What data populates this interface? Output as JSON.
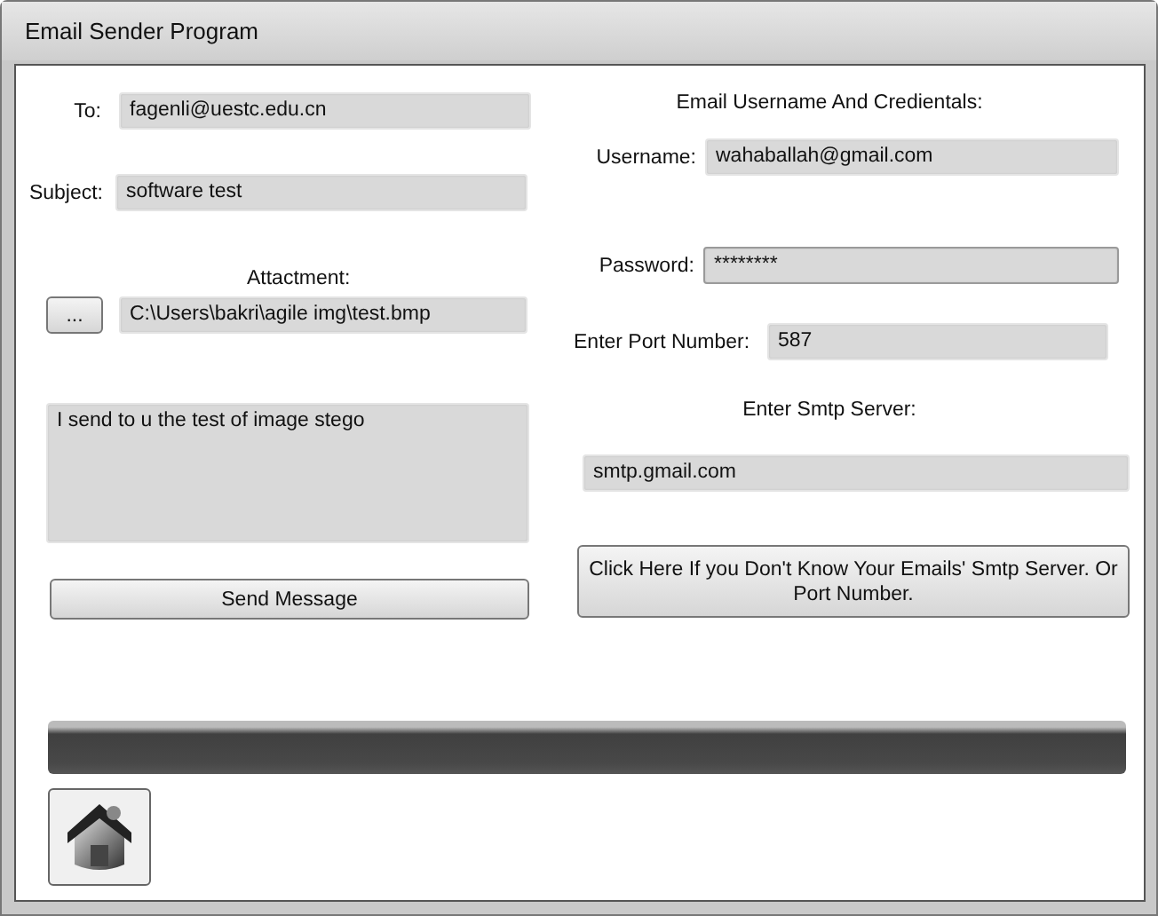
{
  "window": {
    "title": "Email Sender Program"
  },
  "message": {
    "to_label": "To:",
    "to": "fagenli@uestc.edu.cn",
    "subject_label": "Subject:",
    "subject": "software test",
    "attachment_label": "Attactment:",
    "browse_button": "...",
    "attachment": "C:\\Users\\bakri\\agile img\\test.bmp",
    "body": "I send to u the test of image stego",
    "send_button": "Send Message"
  },
  "credentials": {
    "heading": "Email Username And Credientals:",
    "username_label": "Username:",
    "username": "wahaballah@gmail.com",
    "password_label": "Password:",
    "password": "********",
    "port_label": "Enter Port Number:",
    "port": "587",
    "smtp_label": "Enter Smtp Server:",
    "smtp": "smtp.gmail.com",
    "help_button": "Click Here If you Don't Know Your Emails' Smtp Server. Or Port Number."
  },
  "progress": {
    "level": 1
  }
}
